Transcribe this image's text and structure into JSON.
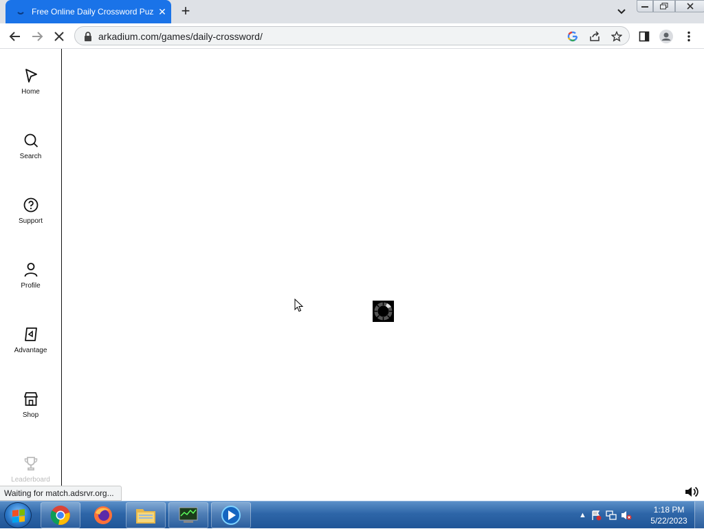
{
  "browser": {
    "tab": {
      "title": "Free Online Daily Crossword Puzzle"
    },
    "new_tab_label": "+",
    "address": {
      "url": "arkadium.com/games/daily-crossword/"
    },
    "status_text": "Waiting for match.adsrvr.org..."
  },
  "sidebar": {
    "items": [
      {
        "label": "Home",
        "icon": "home-icon"
      },
      {
        "label": "Search",
        "icon": "search-icon"
      },
      {
        "label": "Support",
        "icon": "help-icon"
      },
      {
        "label": "Profile",
        "icon": "profile-icon"
      },
      {
        "label": "Advantage",
        "icon": "advantage-icon"
      },
      {
        "label": "Shop",
        "icon": "shop-icon"
      },
      {
        "label": "Leaderboard",
        "icon": "trophy-icon"
      }
    ]
  },
  "taskbar": {
    "apps": [
      "chrome",
      "firefox",
      "file-explorer",
      "system-monitor",
      "media-player"
    ],
    "clock": {
      "time": "1:18 PM",
      "date": "5/22/2023"
    }
  },
  "colors": {
    "tab_active": "#1a73e8",
    "taskbar": "#2e66a8"
  }
}
